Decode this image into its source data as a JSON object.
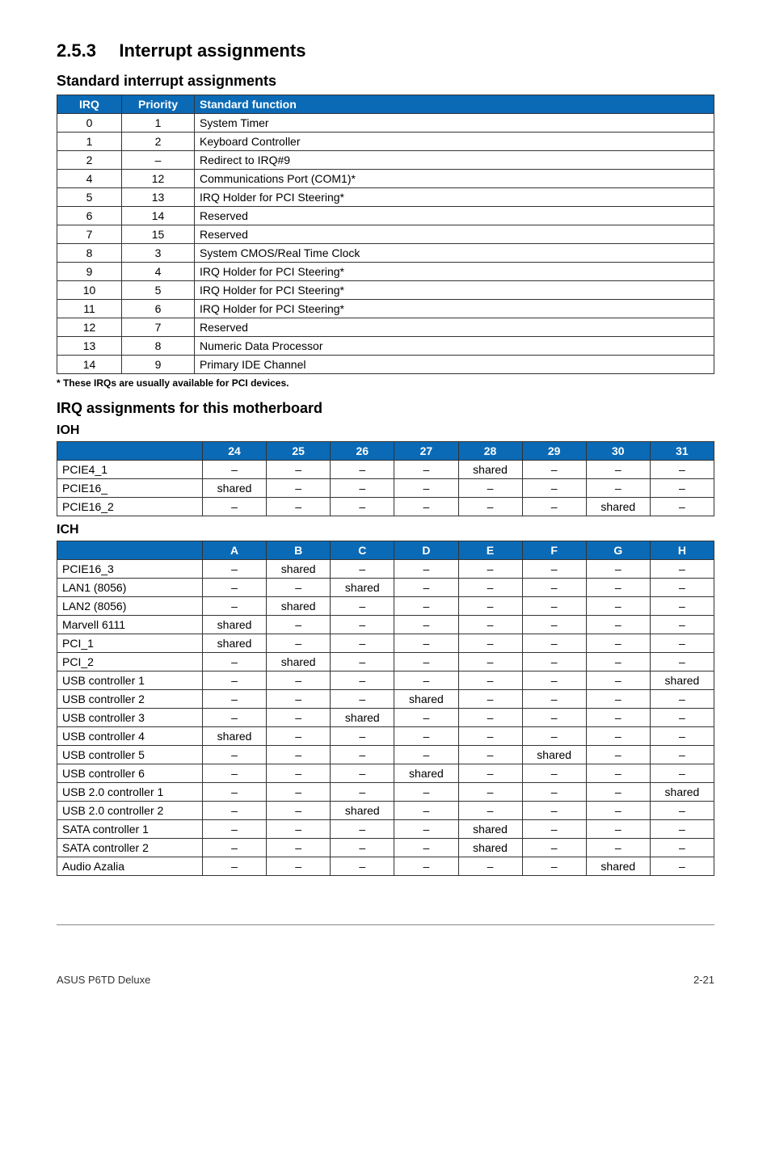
{
  "section": {
    "num": "2.5.3",
    "title": "Interrupt assignments"
  },
  "sub1": "Standard interrupt assignments",
  "irq_head": {
    "c0": "IRQ",
    "c1": "Priority",
    "c2": "Standard function"
  },
  "irq_rows": [
    {
      "irq": "0",
      "pri": "1",
      "fn": "System Timer"
    },
    {
      "irq": "1",
      "pri": "2",
      "fn": "Keyboard Controller"
    },
    {
      "irq": "2",
      "pri": "–",
      "fn": "Redirect to IRQ#9"
    },
    {
      "irq": "4",
      "pri": "12",
      "fn": "Communications Port (COM1)*"
    },
    {
      "irq": "5",
      "pri": "13",
      "fn": "IRQ Holder for PCI Steering*"
    },
    {
      "irq": "6",
      "pri": "14",
      "fn": "Reserved"
    },
    {
      "irq": "7",
      "pri": "15",
      "fn": "Reserved"
    },
    {
      "irq": "8",
      "pri": "3",
      "fn": "System CMOS/Real Time Clock"
    },
    {
      "irq": "9",
      "pri": "4",
      "fn": "IRQ Holder for PCI Steering*"
    },
    {
      "irq": "10",
      "pri": "5",
      "fn": "IRQ Holder for PCI Steering*"
    },
    {
      "irq": "11",
      "pri": "6",
      "fn": "IRQ Holder for PCI Steering*"
    },
    {
      "irq": "12",
      "pri": "7",
      "fn": "Reserved"
    },
    {
      "irq": "13",
      "pri": "8",
      "fn": "Numeric Data Processor"
    },
    {
      "irq": "14",
      "pri": "9",
      "fn": "Primary IDE Channel"
    }
  ],
  "note": "* These IRQs are usually available for PCI devices.",
  "sub2": "IRQ assignments for this motherboard",
  "ioh_title": "IOH",
  "ioh_head": [
    "",
    "24",
    "25",
    "26",
    "27",
    "28",
    "29",
    "30",
    "31"
  ],
  "ioh_rows": [
    {
      "lab": "PCIE4_1",
      "v": [
        "–",
        "–",
        "–",
        "–",
        "shared",
        "–",
        "–",
        "–"
      ]
    },
    {
      "lab": "PCIE16_",
      "v": [
        "shared",
        "–",
        "–",
        "–",
        "–",
        "–",
        "–",
        "–"
      ]
    },
    {
      "lab": "PCIE16_2",
      "v": [
        "–",
        "–",
        "–",
        "–",
        "–",
        "–",
        "shared",
        "–"
      ]
    }
  ],
  "ich_title": "ICH",
  "ich_head": [
    "",
    "A",
    "B",
    "C",
    "D",
    "E",
    "F",
    "G",
    "H"
  ],
  "ich_rows": [
    {
      "lab": "PCIE16_3",
      "v": [
        "–",
        "shared",
        "–",
        "–",
        "–",
        "–",
        "–",
        "–"
      ]
    },
    {
      "lab": "LAN1 (8056)",
      "v": [
        "–",
        "–",
        "shared",
        "–",
        "–",
        "–",
        "–",
        "–"
      ]
    },
    {
      "lab": "LAN2 (8056)",
      "v": [
        "–",
        "shared",
        "–",
        "–",
        "–",
        "–",
        "–",
        "–"
      ]
    },
    {
      "lab": "Marvell 6111",
      "v": [
        "shared",
        "–",
        "–",
        "–",
        "–",
        "–",
        "–",
        "–"
      ]
    },
    {
      "lab": "PCI_1",
      "v": [
        "shared",
        "–",
        "–",
        "–",
        "–",
        "–",
        "–",
        "–"
      ]
    },
    {
      "lab": "PCI_2",
      "v": [
        "–",
        "shared",
        "–",
        "–",
        "–",
        "–",
        "–",
        "–"
      ]
    },
    {
      "lab": "USB controller 1",
      "v": [
        "–",
        "–",
        "–",
        "–",
        "–",
        "–",
        "–",
        "shared"
      ]
    },
    {
      "lab": "USB controller 2",
      "v": [
        "–",
        "–",
        "–",
        "shared",
        "–",
        "–",
        "–",
        "–"
      ]
    },
    {
      "lab": "USB controller 3",
      "v": [
        "–",
        "–",
        "shared",
        "–",
        "–",
        "–",
        "–",
        "–"
      ]
    },
    {
      "lab": "USB controller 4",
      "v": [
        "shared",
        "–",
        "–",
        "–",
        "–",
        "–",
        "–",
        "–"
      ]
    },
    {
      "lab": "USB controller 5",
      "v": [
        "–",
        "–",
        "–",
        "–",
        "–",
        "shared",
        "–",
        "–"
      ]
    },
    {
      "lab": "USB controller 6",
      "v": [
        "–",
        "–",
        "–",
        "shared",
        "–",
        "–",
        "–",
        "–"
      ]
    },
    {
      "lab": "USB 2.0 controller 1",
      "v": [
        "–",
        "–",
        "–",
        "–",
        "–",
        "–",
        "–",
        "shared"
      ]
    },
    {
      "lab": "USB 2.0 controller 2",
      "v": [
        "–",
        "–",
        "shared",
        "–",
        "–",
        "–",
        "–",
        "–"
      ]
    },
    {
      "lab": "SATA controller 1",
      "v": [
        "–",
        "–",
        "–",
        "–",
        "shared",
        "–",
        "–",
        "–"
      ]
    },
    {
      "lab": "SATA controller 2",
      "v": [
        "–",
        "–",
        "–",
        "–",
        "shared",
        "–",
        "–",
        "–"
      ]
    },
    {
      "lab": "Audio Azalia",
      "v": [
        "–",
        "–",
        "–",
        "–",
        "–",
        "–",
        "shared",
        "–"
      ]
    }
  ],
  "footer": {
    "left": "ASUS P6TD Deluxe",
    "right": "2-21"
  }
}
